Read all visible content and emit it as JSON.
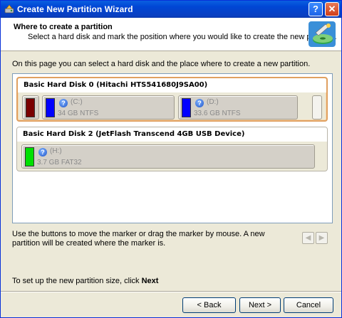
{
  "window": {
    "title": "Create New Partition Wizard",
    "help_glyph": "?",
    "close_glyph": "✕"
  },
  "header": {
    "title": "Where to create a partition",
    "subtitle": "Select a hard disk and mark the position where you would like to create the new partition."
  },
  "intro": "On this page you can select a hard disk and the place where to create a new partition.",
  "disks": [
    {
      "label": "Basic Hard Disk 0 (Hitachi HTS541680J9SA00)",
      "selected": true,
      "partitions": [
        {
          "name": "",
          "size": "",
          "color": "#7a0000"
        },
        {
          "name": "(C:)",
          "size": "34 GB NTFS",
          "color": "#0000ff"
        },
        {
          "name": "(D:)",
          "size": "33.6 GB NTFS",
          "color": "#0000ff"
        }
      ]
    },
    {
      "label": "Basic Hard Disk 2 (JetFlash Transcend 4GB USB Device)",
      "selected": false,
      "partitions": [
        {
          "name": "(H:)",
          "size": "3.7 GB FAT32",
          "color": "#00e000"
        }
      ]
    }
  ],
  "help_text": "Use the buttons to move the marker or drag the marker by mouse. A new partition will be created where the marker is.",
  "arrows": {
    "left": "◀",
    "right": "▶"
  },
  "footer_note": {
    "prefix": "To set up the new partition size, click ",
    "bold": "Next"
  },
  "buttons": {
    "back": "< Back",
    "next": "Next >",
    "cancel": "Cancel"
  },
  "colors": {
    "accent": "#0046d5",
    "selected_border": "#e0a060"
  },
  "icons": [
    "app-icon",
    "help-icon",
    "close-icon",
    "wizard-disk-icon",
    "question-icon",
    "arrow-left-icon",
    "arrow-right-icon"
  ]
}
